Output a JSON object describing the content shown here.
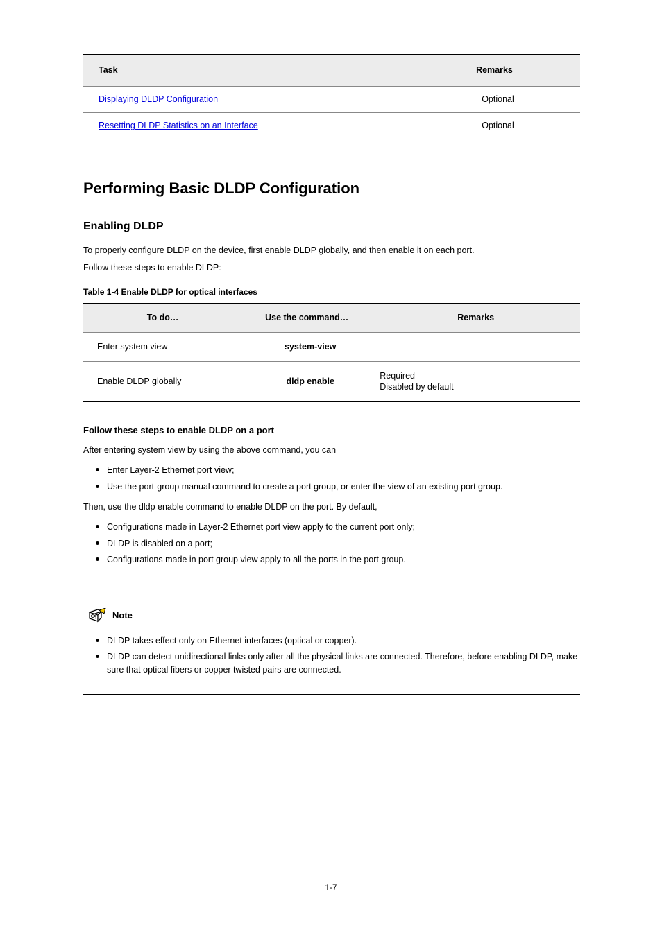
{
  "table1": {
    "head": {
      "task": "Task",
      "remarks": "Remarks"
    },
    "rows": [
      {
        "task": "Displaying DLDP Configuration",
        "remarks": "Optional"
      },
      {
        "task": "Resetting DLDP Statistics on an Interface",
        "remarks": "Optional"
      }
    ]
  },
  "h1": "Performing Basic DLDP Configuration",
  "h2": "Enabling DLDP",
  "body1": "To properly configure DLDP on the device, first enable DLDP globally, and then enable it on each port.",
  "body2": "Follow these steps to enable DLDP:",
  "caption2": "Table 1-4 Enable DLDP for optical interfaces",
  "table2": {
    "head": {
      "todo": "To do…",
      "cmd": "Use the command…",
      "remarks": "Remarks"
    },
    "rows": [
      {
        "todo": "Enter system view",
        "cmd": "system-view",
        "remarks": "—",
        "remarks_align": "center"
      },
      {
        "todo": "Enable DLDP globally",
        "cmd": "dldp enable",
        "remarks": "Required\nDisabled by default"
      }
    ]
  },
  "h3": "Follow these steps to enable DLDP on a port",
  "prelist1": "After entering system view by using the above command, you can",
  "list1": [
    "Enter Layer-2 Ethernet port view;",
    "Use the port-group manual command to create a port group, or enter the view of an existing port group."
  ],
  "prelist2": "Then, use the dldp enable command to enable DLDP on the port. By default,",
  "list2": [
    "Configurations made in Layer-2 Ethernet port view apply to the current port only;",
    "DLDP is disabled on a port;",
    "Configurations made in port group view apply to all the ports in the port group."
  ],
  "note": {
    "label": "Note",
    "items": [
      "DLDP takes effect only on Ethernet interfaces (optical or copper).",
      "DLDP can detect unidirectional links only after all the physical links are connected. Therefore, before enabling DLDP, make sure that optical fibers or copper twisted pairs are connected."
    ]
  },
  "page": "1-7"
}
